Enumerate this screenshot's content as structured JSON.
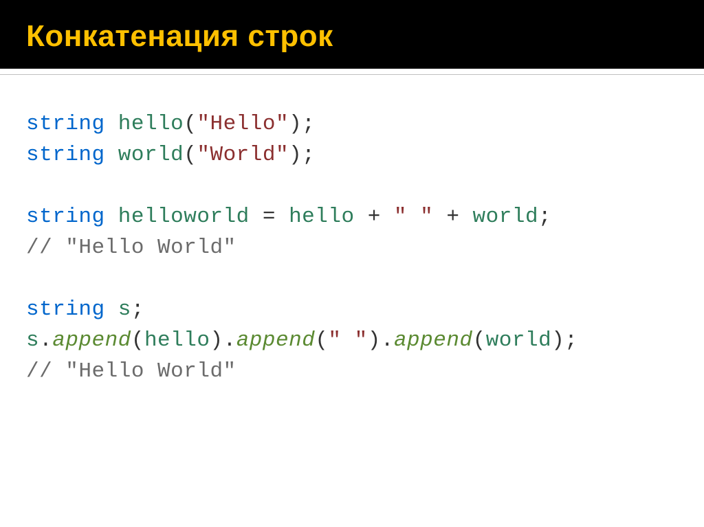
{
  "slide": {
    "title": "Конкатенация строк"
  },
  "code": {
    "kw_string": "string",
    "var_hello": "hello",
    "var_world": "world",
    "var_helloworld": "helloworld",
    "var_s": "s",
    "lit_hello": "\"Hello\"",
    "lit_world": "\"World\"",
    "lit_space": "\" \"",
    "meth_append": "append",
    "comment_hw": "// \"Hello World\""
  }
}
